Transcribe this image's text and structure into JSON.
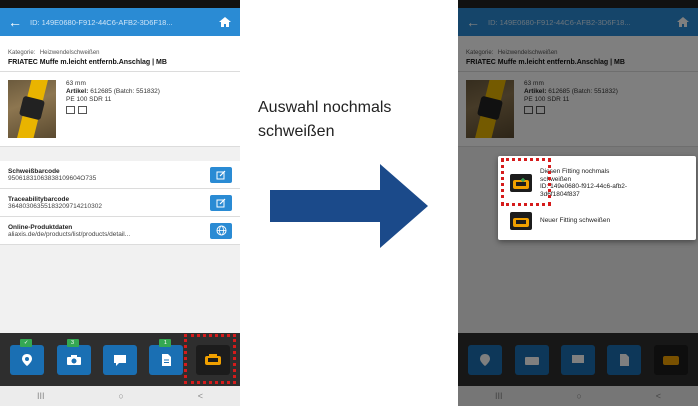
{
  "left_phone": {
    "appbar": {
      "title": "ID: 149E0680-F912-44C6-AFB2-3D6F18..."
    },
    "category": {
      "label": "Kategorie:",
      "value": "Heizwendelschweißen"
    },
    "product_name": "FRIATEC Muffe m.leicht entfernb.Anschlag | MB",
    "details": {
      "size": "63 mm",
      "artikel_label": "Artikel:",
      "artikel_value": "612685 (Batch: 551832)",
      "pe": "PE 100 SDR 11"
    },
    "rows": [
      {
        "label": "Schweißbarcode",
        "value": "95061831063838109604O735"
      },
      {
        "label": "Traceabilitybarcode",
        "value": "36480306355183209714210302"
      },
      {
        "label": "Online-Produktdaten",
        "value": "aliaxis.de/de/products/list/products/detail..."
      }
    ],
    "tabs": [
      {
        "icon": "location-pin-icon",
        "badge": "✓"
      },
      {
        "icon": "camera-icon",
        "badge": "3"
      },
      {
        "icon": "chat-icon",
        "badge": ""
      },
      {
        "icon": "document-icon",
        "badge": "1"
      },
      {
        "icon": "welding-machine-icon",
        "badge": ""
      }
    ],
    "nav": {
      "recent": "III",
      "home": "○",
      "back": "<"
    }
  },
  "caption": {
    "line1": "Auswahl nochmals",
    "line2": "schweißen"
  },
  "right_phone": {
    "appbar": {
      "title": "ID: 149E0680-F912-44C6-AFB2-3D6F18..."
    },
    "category": {
      "label": "Kategorie:",
      "value": "Heizwendelschweißen"
    },
    "product_name": "FRIATEC Muffe m.leicht entfernb.Anschlag | MB",
    "details": {
      "size": "63 mm",
      "artikel_label": "Artikel:",
      "artikel_value": "612685 (Batch: 551832)",
      "pe": "PE 100 SDR 11"
    },
    "dialog": {
      "option1": {
        "line1": "Diesen Fitting nochmals",
        "line2": "schweißen",
        "line3": "ID: 149e0680-f912-44c6-afb2-",
        "line4": "3d6f1804f837"
      },
      "option2": "Neuer Fitting schweißen"
    },
    "nav": {
      "recent": "III",
      "home": "○",
      "back": "<"
    }
  },
  "colors": {
    "appbar": "#2a8bd4",
    "highlight": "#d51b1b",
    "arrow": "#1b4a8a",
    "accent_orange": "#f0a000"
  }
}
